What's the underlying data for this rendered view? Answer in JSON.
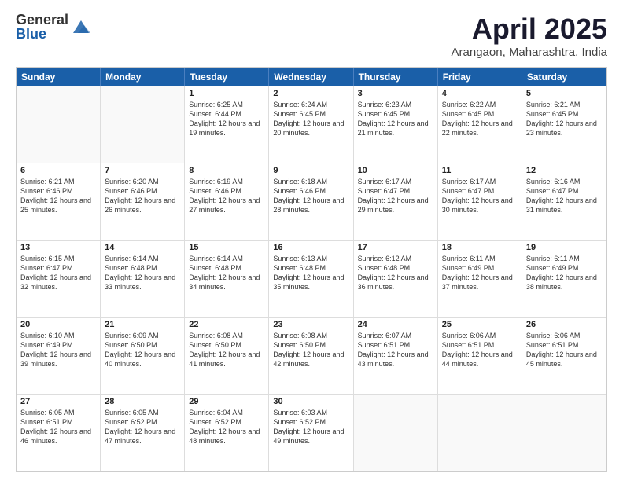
{
  "logo": {
    "general": "General",
    "blue": "Blue"
  },
  "title": "April 2025",
  "location": "Arangaon, Maharashtra, India",
  "header_days": [
    "Sunday",
    "Monday",
    "Tuesday",
    "Wednesday",
    "Thursday",
    "Friday",
    "Saturday"
  ],
  "weeks": [
    [
      {
        "day": "",
        "sunrise": "",
        "sunset": "",
        "daylight": ""
      },
      {
        "day": "",
        "sunrise": "",
        "sunset": "",
        "daylight": ""
      },
      {
        "day": "1",
        "sunrise": "Sunrise: 6:25 AM",
        "sunset": "Sunset: 6:44 PM",
        "daylight": "Daylight: 12 hours and 19 minutes."
      },
      {
        "day": "2",
        "sunrise": "Sunrise: 6:24 AM",
        "sunset": "Sunset: 6:45 PM",
        "daylight": "Daylight: 12 hours and 20 minutes."
      },
      {
        "day": "3",
        "sunrise": "Sunrise: 6:23 AM",
        "sunset": "Sunset: 6:45 PM",
        "daylight": "Daylight: 12 hours and 21 minutes."
      },
      {
        "day": "4",
        "sunrise": "Sunrise: 6:22 AM",
        "sunset": "Sunset: 6:45 PM",
        "daylight": "Daylight: 12 hours and 22 minutes."
      },
      {
        "day": "5",
        "sunrise": "Sunrise: 6:21 AM",
        "sunset": "Sunset: 6:45 PM",
        "daylight": "Daylight: 12 hours and 23 minutes."
      }
    ],
    [
      {
        "day": "6",
        "sunrise": "Sunrise: 6:21 AM",
        "sunset": "Sunset: 6:46 PM",
        "daylight": "Daylight: 12 hours and 25 minutes."
      },
      {
        "day": "7",
        "sunrise": "Sunrise: 6:20 AM",
        "sunset": "Sunset: 6:46 PM",
        "daylight": "Daylight: 12 hours and 26 minutes."
      },
      {
        "day": "8",
        "sunrise": "Sunrise: 6:19 AM",
        "sunset": "Sunset: 6:46 PM",
        "daylight": "Daylight: 12 hours and 27 minutes."
      },
      {
        "day": "9",
        "sunrise": "Sunrise: 6:18 AM",
        "sunset": "Sunset: 6:46 PM",
        "daylight": "Daylight: 12 hours and 28 minutes."
      },
      {
        "day": "10",
        "sunrise": "Sunrise: 6:17 AM",
        "sunset": "Sunset: 6:47 PM",
        "daylight": "Daylight: 12 hours and 29 minutes."
      },
      {
        "day": "11",
        "sunrise": "Sunrise: 6:17 AM",
        "sunset": "Sunset: 6:47 PM",
        "daylight": "Daylight: 12 hours and 30 minutes."
      },
      {
        "day": "12",
        "sunrise": "Sunrise: 6:16 AM",
        "sunset": "Sunset: 6:47 PM",
        "daylight": "Daylight: 12 hours and 31 minutes."
      }
    ],
    [
      {
        "day": "13",
        "sunrise": "Sunrise: 6:15 AM",
        "sunset": "Sunset: 6:47 PM",
        "daylight": "Daylight: 12 hours and 32 minutes."
      },
      {
        "day": "14",
        "sunrise": "Sunrise: 6:14 AM",
        "sunset": "Sunset: 6:48 PM",
        "daylight": "Daylight: 12 hours and 33 minutes."
      },
      {
        "day": "15",
        "sunrise": "Sunrise: 6:14 AM",
        "sunset": "Sunset: 6:48 PM",
        "daylight": "Daylight: 12 hours and 34 minutes."
      },
      {
        "day": "16",
        "sunrise": "Sunrise: 6:13 AM",
        "sunset": "Sunset: 6:48 PM",
        "daylight": "Daylight: 12 hours and 35 minutes."
      },
      {
        "day": "17",
        "sunrise": "Sunrise: 6:12 AM",
        "sunset": "Sunset: 6:48 PM",
        "daylight": "Daylight: 12 hours and 36 minutes."
      },
      {
        "day": "18",
        "sunrise": "Sunrise: 6:11 AM",
        "sunset": "Sunset: 6:49 PM",
        "daylight": "Daylight: 12 hours and 37 minutes."
      },
      {
        "day": "19",
        "sunrise": "Sunrise: 6:11 AM",
        "sunset": "Sunset: 6:49 PM",
        "daylight": "Daylight: 12 hours and 38 minutes."
      }
    ],
    [
      {
        "day": "20",
        "sunrise": "Sunrise: 6:10 AM",
        "sunset": "Sunset: 6:49 PM",
        "daylight": "Daylight: 12 hours and 39 minutes."
      },
      {
        "day": "21",
        "sunrise": "Sunrise: 6:09 AM",
        "sunset": "Sunset: 6:50 PM",
        "daylight": "Daylight: 12 hours and 40 minutes."
      },
      {
        "day": "22",
        "sunrise": "Sunrise: 6:08 AM",
        "sunset": "Sunset: 6:50 PM",
        "daylight": "Daylight: 12 hours and 41 minutes."
      },
      {
        "day": "23",
        "sunrise": "Sunrise: 6:08 AM",
        "sunset": "Sunset: 6:50 PM",
        "daylight": "Daylight: 12 hours and 42 minutes."
      },
      {
        "day": "24",
        "sunrise": "Sunrise: 6:07 AM",
        "sunset": "Sunset: 6:51 PM",
        "daylight": "Daylight: 12 hours and 43 minutes."
      },
      {
        "day": "25",
        "sunrise": "Sunrise: 6:06 AM",
        "sunset": "Sunset: 6:51 PM",
        "daylight": "Daylight: 12 hours and 44 minutes."
      },
      {
        "day": "26",
        "sunrise": "Sunrise: 6:06 AM",
        "sunset": "Sunset: 6:51 PM",
        "daylight": "Daylight: 12 hours and 45 minutes."
      }
    ],
    [
      {
        "day": "27",
        "sunrise": "Sunrise: 6:05 AM",
        "sunset": "Sunset: 6:51 PM",
        "daylight": "Daylight: 12 hours and 46 minutes."
      },
      {
        "day": "28",
        "sunrise": "Sunrise: 6:05 AM",
        "sunset": "Sunset: 6:52 PM",
        "daylight": "Daylight: 12 hours and 47 minutes."
      },
      {
        "day": "29",
        "sunrise": "Sunrise: 6:04 AM",
        "sunset": "Sunset: 6:52 PM",
        "daylight": "Daylight: 12 hours and 48 minutes."
      },
      {
        "day": "30",
        "sunrise": "Sunrise: 6:03 AM",
        "sunset": "Sunset: 6:52 PM",
        "daylight": "Daylight: 12 hours and 49 minutes."
      },
      {
        "day": "",
        "sunrise": "",
        "sunset": "",
        "daylight": ""
      },
      {
        "day": "",
        "sunrise": "",
        "sunset": "",
        "daylight": ""
      },
      {
        "day": "",
        "sunrise": "",
        "sunset": "",
        "daylight": ""
      }
    ]
  ]
}
